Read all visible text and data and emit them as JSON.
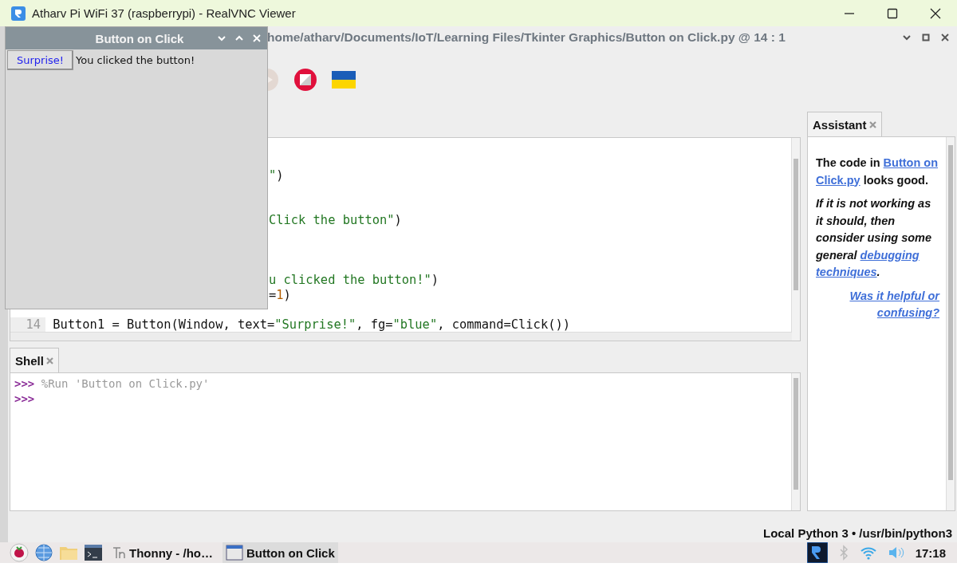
{
  "viewer_title": "Atharv Pi WiFi 37 (raspberrypi) - RealVNC Viewer",
  "thonny": {
    "title_path": "home/atharv/Documents/IoT/Learning Files/Tkinter Graphics/Button on Click.py  @  14 : 1",
    "editor_lines": [
      {
        "kind": "blank"
      },
      {
        "kind": "blank"
      },
      {
        "kind": "fragment",
        "segments": [
          {
            "kind": "string",
            "text": "\""
          },
          {
            "kind": "plain",
            "text": ")"
          }
        ]
      },
      {
        "kind": "blank"
      },
      {
        "kind": "blank"
      },
      {
        "kind": "fragment",
        "segments": [
          {
            "kind": "string",
            "text": "Click the button\""
          },
          {
            "kind": "plain",
            "text": ")"
          }
        ]
      },
      {
        "kind": "blank"
      },
      {
        "kind": "blank"
      },
      {
        "kind": "blank"
      },
      {
        "kind": "fragment",
        "segments": [
          {
            "kind": "string",
            "text": "u clicked the button!\""
          },
          {
            "kind": "plain",
            "text": ")"
          }
        ]
      },
      {
        "kind": "fragment",
        "segments": [
          {
            "kind": "plain",
            "text": "="
          },
          {
            "kind": "number",
            "text": "1"
          },
          {
            "kind": "plain",
            "text": ")"
          }
        ]
      },
      {
        "kind": "blank"
      },
      {
        "kind": "full",
        "number": "14",
        "segments": [
          {
            "kind": "plain",
            "text": "Button1 = Button(Window, text="
          },
          {
            "kind": "string",
            "text": "\"Surprise!\""
          },
          {
            "kind": "plain",
            "text": ", fg="
          },
          {
            "kind": "string",
            "text": "\"blue\""
          },
          {
            "kind": "plain",
            "text": ", command=Click())"
          }
        ]
      }
    ],
    "shell_tab": "Shell",
    "shell_lines": [
      {
        "prompt": ">>>",
        "command": "%Run 'Button on Click.py'"
      },
      {
        "prompt": ">>>"
      }
    ],
    "assistant_tab": "Assistant",
    "assistant_paragraphs": [
      {
        "kind": "plain",
        "parts": [
          {
            "kind": "text",
            "text": "The code in "
          },
          {
            "kind": "link",
            "text": "Button on"
          },
          {
            "kind": "break"
          },
          {
            "kind": "link",
            "text": "Click.py"
          },
          {
            "kind": "text",
            "text": " looks good."
          }
        ]
      },
      {
        "kind": "italic",
        "parts": [
          {
            "kind": "text",
            "text": "If it is not working as it should, then consider using some general "
          },
          {
            "kind": "link",
            "text": "debugging"
          },
          {
            "kind": "break"
          },
          {
            "kind": "link",
            "text": "techniques"
          },
          {
            "kind": "text",
            "text": "."
          }
        ]
      }
    ],
    "assistant_feedback": "Was it helpful or confusing?",
    "status": "Local Python 3  •  /usr/bin/python3"
  },
  "popup": {
    "title": "Button on Click",
    "button": "Surprise!",
    "label": "You clicked the button!"
  },
  "taskbar": {
    "items": [
      {
        "kind": "thonny",
        "label": "Thonny  -  /ho…",
        "selected": false
      },
      {
        "kind": "window",
        "label": "Button on Click",
        "selected": true
      }
    ],
    "clock": "17:18"
  }
}
